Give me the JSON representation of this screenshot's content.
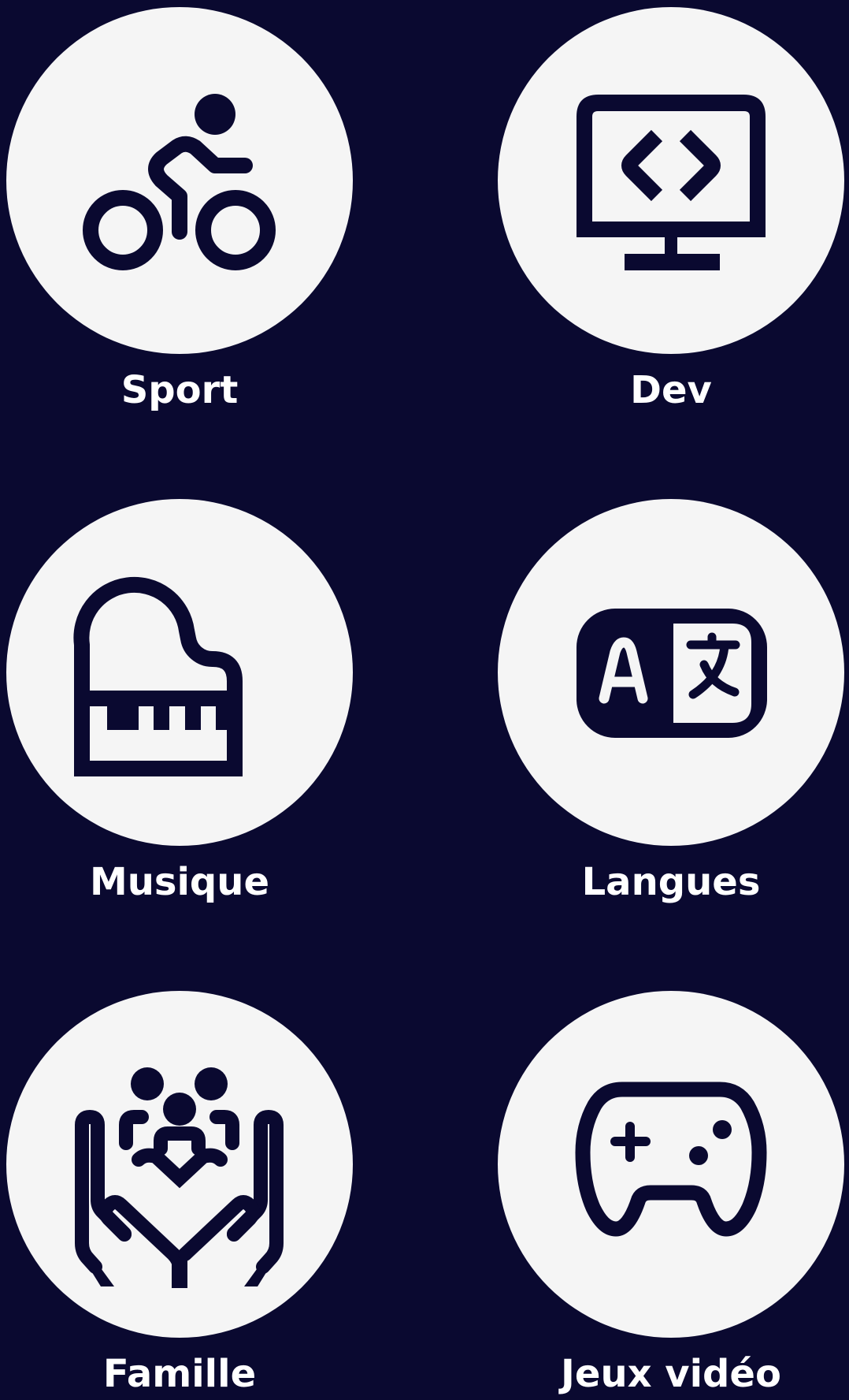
{
  "colors": {
    "background": "#0a0930",
    "circle": "#f5f5f5",
    "label": "#ffffff"
  },
  "categories": [
    {
      "label": "Sport",
      "icon": "bicycle-rider-icon"
    },
    {
      "label": "Dev",
      "icon": "code-monitor-icon"
    },
    {
      "label": "Musique",
      "icon": "piano-icon"
    },
    {
      "label": "Langues",
      "icon": "translate-icon"
    },
    {
      "label": "Famille",
      "icon": "family-hands-icon"
    },
    {
      "label": "Jeux vidéo",
      "icon": "gamepad-icon"
    }
  ]
}
